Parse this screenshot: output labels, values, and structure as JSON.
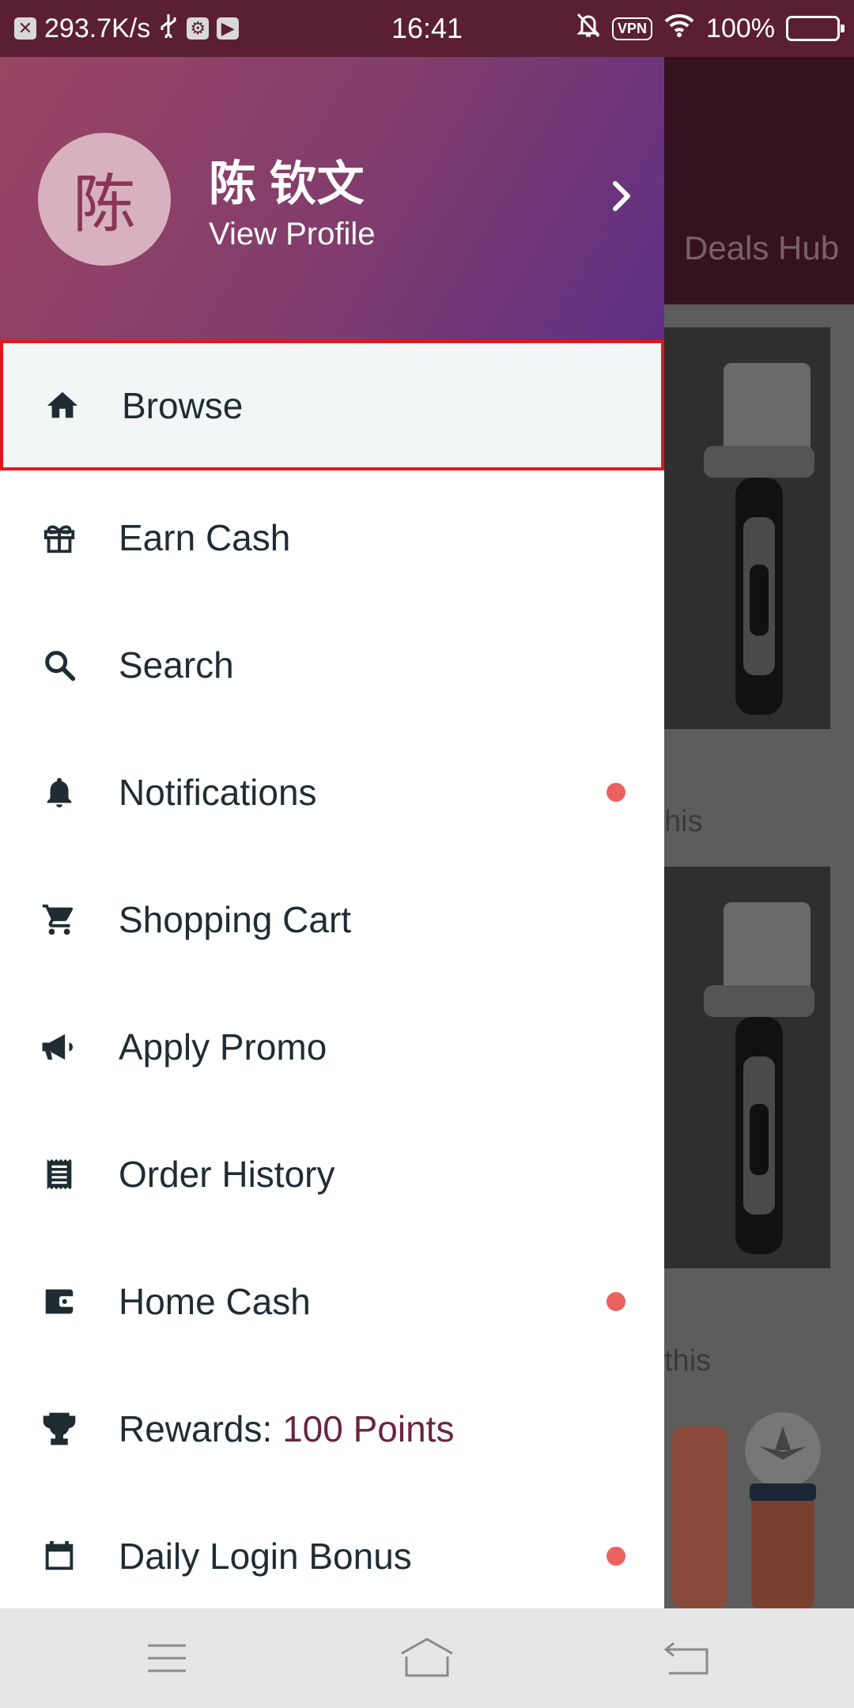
{
  "status_bar": {
    "net_speed": "293.7K/s",
    "time": "16:41",
    "vpn": "VPN",
    "battery": "100%"
  },
  "background": {
    "tab_label": "Deals Hub",
    "caption_1": "his",
    "caption_2": "this"
  },
  "drawer": {
    "avatar_initial": "陈",
    "user_name": "陈 钦文",
    "view_profile": "View Profile",
    "items": [
      {
        "label": "Browse",
        "icon": "home-icon"
      },
      {
        "label": "Earn Cash",
        "icon": "gift-icon"
      },
      {
        "label": "Search",
        "icon": "search-icon"
      },
      {
        "label": "Notifications",
        "icon": "bell-icon",
        "badge": true
      },
      {
        "label": "Shopping Cart",
        "icon": "cart-icon"
      },
      {
        "label": "Apply Promo",
        "icon": "megaphone-icon"
      },
      {
        "label": "Order History",
        "icon": "receipt-icon"
      },
      {
        "label": "Home Cash",
        "icon": "wallet-icon",
        "badge": true
      },
      {
        "label": "Rewards: ",
        "accent": "100 Points",
        "icon": "trophy-icon"
      },
      {
        "label": "Daily Login Bonus",
        "icon": "calendar-icon",
        "badge": true
      }
    ]
  },
  "colors": {
    "status_bar": "#5a1f33",
    "header_start": "#9a4563",
    "header_end": "#5f2e85",
    "active_border": "#e5151b",
    "badge": "#e96260",
    "accent_text": "#6b2440"
  }
}
